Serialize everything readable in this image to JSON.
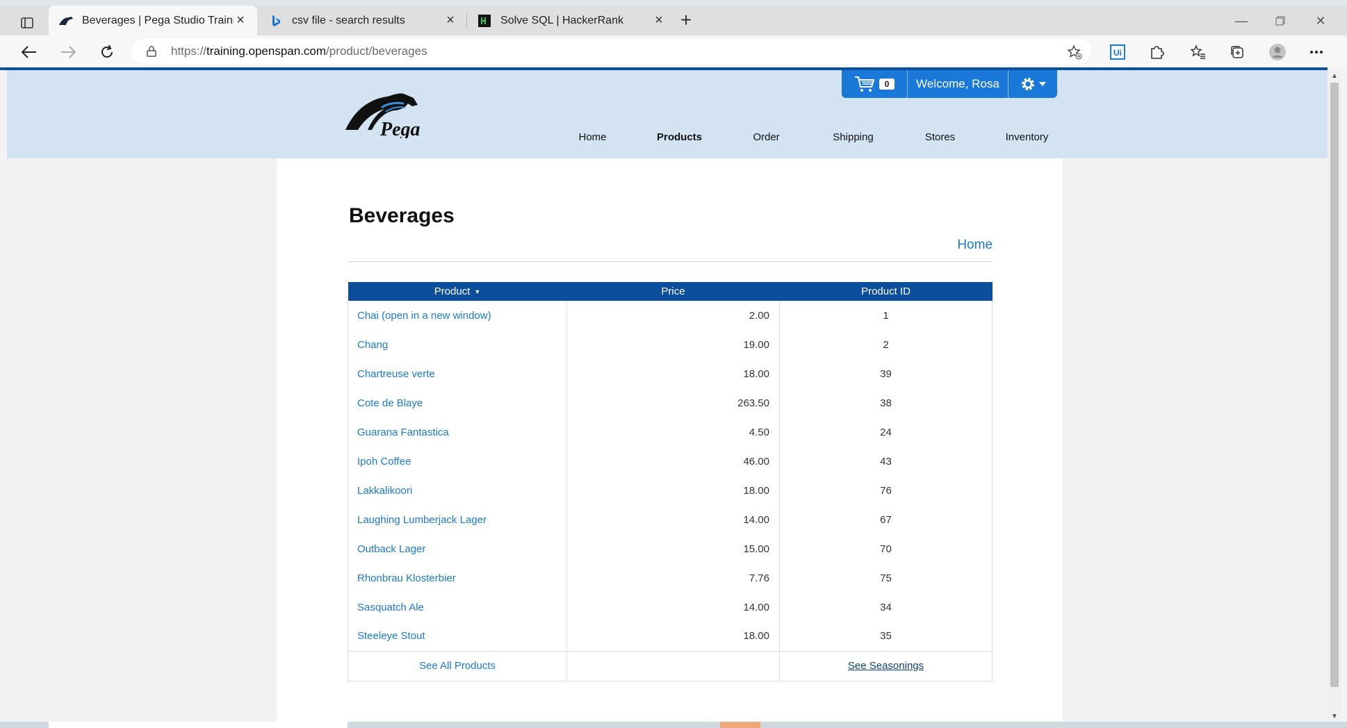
{
  "browser": {
    "tabs": [
      {
        "title": "Beverages | Pega Studio Training",
        "favicon": "pega-horse-icon",
        "active": true
      },
      {
        "title": "csv file - search results",
        "favicon": "bing-icon",
        "active": false
      },
      {
        "title": "Solve SQL | HackerRank",
        "favicon": "hackerrank-icon",
        "active": false
      }
    ],
    "url_prefix": "https://",
    "url_domain": "training.openspan.com",
    "url_path": "/product/beverages"
  },
  "header": {
    "logo_text": "Pega",
    "cart_count": "0",
    "welcome": "Welcome, Rosa",
    "nav": [
      "Home",
      "Products",
      "Order",
      "Shipping",
      "Stores",
      "Inventory"
    ],
    "active_nav": "Products"
  },
  "page": {
    "title": "Beverages",
    "home_link": "Home"
  },
  "table": {
    "headers": [
      "Product",
      "Price",
      "Product ID"
    ],
    "rows": [
      {
        "name": "Chai  (open in a new window)",
        "price": "2.00",
        "id": "1"
      },
      {
        "name": "Chang",
        "price": "19.00",
        "id": "2"
      },
      {
        "name": "Chartreuse verte",
        "price": "18.00",
        "id": "39"
      },
      {
        "name": "Cote de Blaye",
        "price": "263.50",
        "id": "38"
      },
      {
        "name": "Guarana Fantastica",
        "price": "4.50",
        "id": "24"
      },
      {
        "name": "Ipoh Coffee",
        "price": "46.00",
        "id": "43"
      },
      {
        "name": "Lakkalikoori",
        "price": "18.00",
        "id": "76"
      },
      {
        "name": "Laughing Lumberjack Lager",
        "price": "14.00",
        "id": "67"
      },
      {
        "name": "Outback Lager",
        "price": "15.00",
        "id": "70"
      },
      {
        "name": "Rhonbrau Klosterbier",
        "price": "7.76",
        "id": "75"
      },
      {
        "name": "Sasquatch Ale",
        "price": "14.00",
        "id": "34"
      },
      {
        "name": "Steeleye Stout",
        "price": "18.00",
        "id": "35"
      }
    ],
    "footer_all": "See All Products",
    "footer_seasonings": "See Seasonings"
  },
  "colors": {
    "header_bg": "#d3e3f1",
    "accent_blue": "#1a78d8",
    "table_header": "#0c4d9c"
  }
}
